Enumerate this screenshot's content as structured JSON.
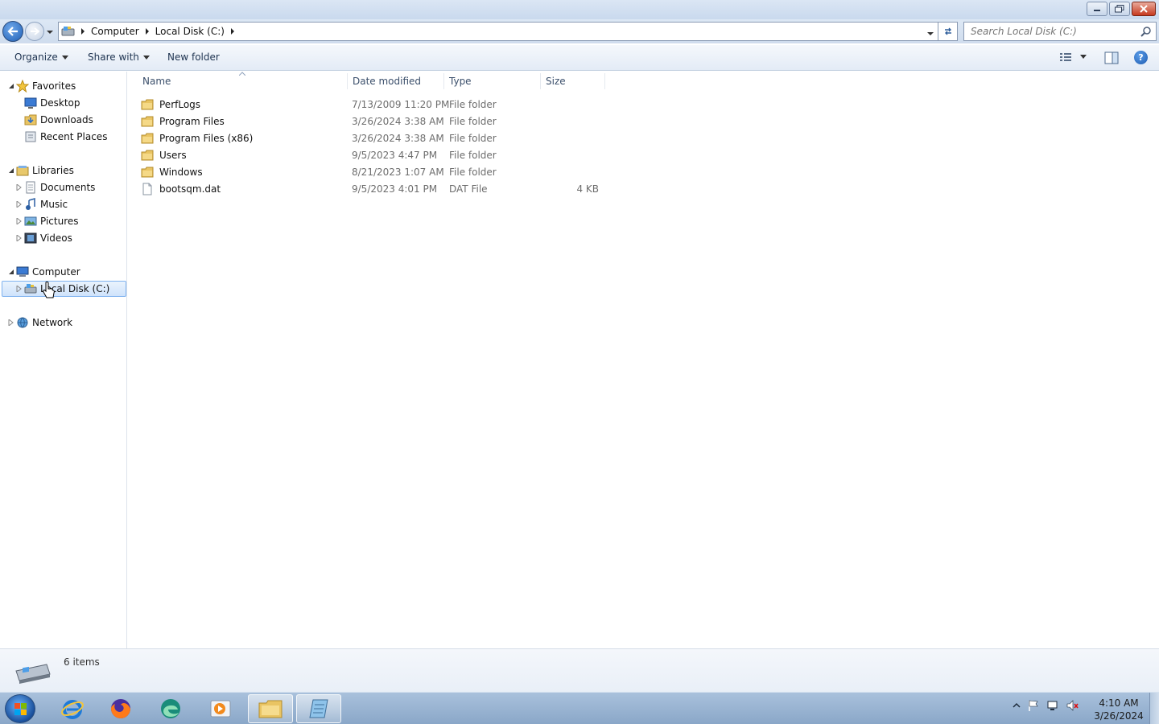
{
  "window": {
    "buttons": [
      "minimize",
      "maximize",
      "close"
    ]
  },
  "address": {
    "crumbs": [
      "Computer",
      "Local Disk (C:)"
    ],
    "search_placeholder": "Search Local Disk (C:)"
  },
  "toolbar": {
    "organize": "Organize",
    "share_with": "Share with",
    "new_folder": "New folder"
  },
  "nav": {
    "favorites": "Favorites",
    "desktop": "Desktop",
    "downloads": "Downloads",
    "recent_places": "Recent Places",
    "libraries": "Libraries",
    "documents": "Documents",
    "music": "Music",
    "pictures": "Pictures",
    "videos": "Videos",
    "computer": "Computer",
    "local_disk": "Local Disk (C:)",
    "network": "Network"
  },
  "columns": {
    "name": "Name",
    "date": "Date modified",
    "type": "Type",
    "size": "Size"
  },
  "files": [
    {
      "name": "PerfLogs",
      "date": "7/13/2009 11:20 PM",
      "type": "File folder",
      "size": "",
      "kind": "folder"
    },
    {
      "name": "Program Files",
      "date": "3/26/2024 3:38 AM",
      "type": "File folder",
      "size": "",
      "kind": "folder"
    },
    {
      "name": "Program Files (x86)",
      "date": "3/26/2024 3:38 AM",
      "type": "File folder",
      "size": "",
      "kind": "folder"
    },
    {
      "name": "Users",
      "date": "9/5/2023 4:47 PM",
      "type": "File folder",
      "size": "",
      "kind": "folder"
    },
    {
      "name": "Windows",
      "date": "8/21/2023 1:07 AM",
      "type": "File folder",
      "size": "",
      "kind": "folder"
    },
    {
      "name": "bootsqm.dat",
      "date": "9/5/2023 4:01 PM",
      "type": "DAT File",
      "size": "4 KB",
      "kind": "file"
    }
  ],
  "status": {
    "item_count": "6 items"
  },
  "taskbar": {
    "apps": [
      "internet-explorer",
      "firefox",
      "edge",
      "media-player",
      "file-explorer",
      "notepad"
    ],
    "time": "4:10 AM",
    "date": "3/26/2024"
  },
  "colors": {
    "accent": "#1f5fb5",
    "selection": "#cfe3fb",
    "taskbar": "#8aa7c8"
  }
}
